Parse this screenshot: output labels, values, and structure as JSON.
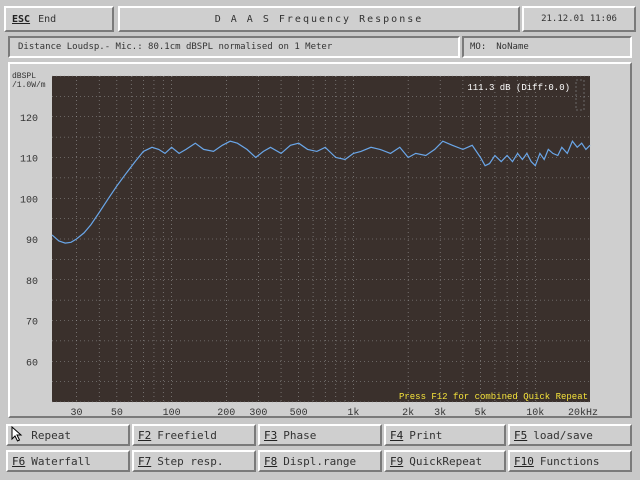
{
  "header": {
    "esc_key": "ESC",
    "esc_label": "End",
    "title": "D A A S   Frequency Response",
    "datetime": "21.12.01 11:06"
  },
  "info": {
    "description": "Distance Loudsp.- Mic.: 80.1cm dBSPL normalised on 1 Meter",
    "mo_label": "MO:",
    "mo_value": "NoName"
  },
  "plot": {
    "readout": "111.3 dB (Diff:0.0)",
    "hint": "Press F12 for combined Quick Repeat"
  },
  "function_keys": [
    {
      "key": "F1",
      "label": "Repeat",
      "icon": "cursor-arrow-icon"
    },
    {
      "key": "F2",
      "label": "Freefield"
    },
    {
      "key": "F3",
      "label": "Phase"
    },
    {
      "key": "F4",
      "label": "Print"
    },
    {
      "key": "F5",
      "label": "load/save"
    },
    {
      "key": "F6",
      "label": "Waterfall"
    },
    {
      "key": "F7",
      "label": "Step resp."
    },
    {
      "key": "F8",
      "label": "Displ.range"
    },
    {
      "key": "F9",
      "label": "QuickRepeat"
    },
    {
      "key": "F10",
      "label": "Functions"
    }
  ],
  "colors": {
    "plot_bg": "#3a302c",
    "curve": "#6aa6e8",
    "grid": "#9a9a9a",
    "hint": "#f4e23a",
    "readout": "#ffffff"
  },
  "chart_data": {
    "type": "line",
    "ylabel_line1": "dBSPL",
    "ylabel_line2": "/1.0W/m",
    "x_scale": "log",
    "xlim": [
      22,
      20000
    ],
    "ylim": [
      50,
      130
    ],
    "grid": true,
    "y_ticks": [
      "120",
      "110",
      "100",
      "90",
      "80",
      "70",
      "60"
    ],
    "y_tick_values": [
      120,
      110,
      100,
      90,
      80,
      70,
      60
    ],
    "x_ticks": [
      "30",
      "50",
      "100",
      "200",
      "300",
      "500",
      "1k",
      "2k",
      "3k",
      "5k",
      "10k",
      "20kHz"
    ],
    "x_tick_values": [
      30,
      50,
      100,
      200,
      300,
      500,
      1000,
      2000,
      3000,
      5000,
      10000,
      20000
    ],
    "series": [
      {
        "x": [
          22,
          24,
          26,
          28,
          30,
          33,
          36,
          40,
          45,
          50,
          56,
          63,
          70,
          78,
          85,
          92,
          100,
          110,
          120,
          135,
          150,
          170,
          190,
          210,
          230,
          260,
          290,
          320,
          350,
          400,
          450,
          500,
          560,
          630,
          700,
          800,
          900,
          1000,
          1100,
          1250,
          1400,
          1600,
          1800,
          2000,
          2200,
          2500,
          2800,
          3100,
          3500,
          4000,
          4500,
          5000,
          5300,
          5600,
          6000,
          6500,
          7000,
          7500,
          8000,
          8500,
          9000,
          9500,
          10000,
          10600,
          11200,
          11800,
          12500,
          13300,
          14000,
          15000,
          16000,
          17000,
          18000,
          19000,
          20000
        ],
        "y": [
          91,
          89.5,
          89,
          89.2,
          90,
          91.5,
          93.5,
          96.5,
          100,
          103,
          106,
          109,
          111.5,
          112.5,
          112,
          111,
          112.5,
          111,
          112,
          113.5,
          112,
          111.5,
          113,
          114,
          113.5,
          112,
          110,
          111.5,
          112.5,
          111,
          113,
          113.5,
          112,
          111.5,
          112.5,
          110,
          109.5,
          111,
          111.5,
          112.5,
          112,
          111,
          112.5,
          110,
          111,
          110.5,
          112,
          114,
          113,
          112,
          113,
          110,
          108,
          108.5,
          110.5,
          109,
          110.5,
          109,
          111,
          109.5,
          111,
          109,
          108,
          111,
          109.5,
          112,
          111,
          110.5,
          112.5,
          111,
          114,
          112.5,
          113.5,
          112,
          113
        ]
      }
    ]
  }
}
